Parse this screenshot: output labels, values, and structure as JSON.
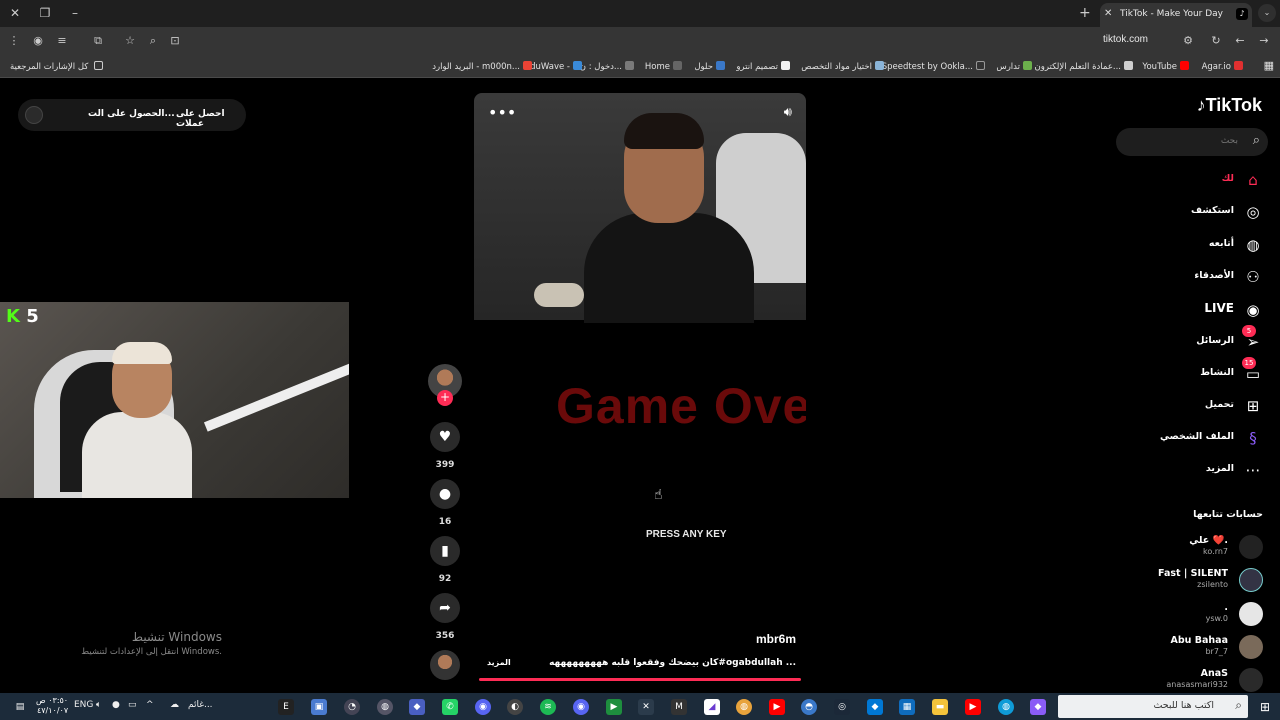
{
  "browser": {
    "tab_title": "TikTok - Make Your Day",
    "url": "tiktok.com",
    "bookmarks_folder": "كل الإشارات المرجعية",
    "bookmarks": [
      {
        "label": "Agar.io",
        "color": "#e03030"
      },
      {
        "label": "YouTube",
        "color": "#ff0000"
      },
      {
        "label": "عمادة التعلم الإلكترون...",
        "color": "#cfcfcf"
      },
      {
        "label": "تدارس",
        "color": "#6cb04c"
      },
      {
        "label": "Speedtest by Ookla...",
        "color": "#333333"
      },
      {
        "label": "اختيار مواد التخصص",
        "color": "#8ab4d8"
      },
      {
        "label": "تصميم انترو",
        "color": "#f0f0f0"
      },
      {
        "label": "حلول",
        "color": "#3a78c8"
      },
      {
        "label": "Home",
        "color": "#666666"
      },
      {
        "label": "دخول : ن...",
        "color": "#7a7a7a"
      },
      {
        "label": "EduWave -",
        "color": "#3a8ad8"
      },
      {
        "label": "البريد الوارد - m000n...",
        "color": "#ea4335"
      }
    ]
  },
  "tiktok": {
    "logo": "TikTok",
    "search_placeholder": "بحث",
    "get_coins": "احصل على عملات",
    "get_app": "الحصول على الت...",
    "nav": [
      {
        "label": "لك",
        "icon": "home-icon",
        "active": true
      },
      {
        "label": "استكشف",
        "icon": "compass-icon"
      },
      {
        "label": "أتابعه",
        "icon": "avatar-icon"
      },
      {
        "label": "الأصدقاء",
        "icon": "friends-icon"
      },
      {
        "label": "LIVE",
        "icon": "live-icon"
      },
      {
        "label": "الرسائل",
        "icon": "send-icon",
        "badge": "5"
      },
      {
        "label": "النشاط",
        "icon": "inbox-icon",
        "badge": "15"
      },
      {
        "label": "تحميل",
        "icon": "upload-icon"
      },
      {
        "label": "الملف الشخصي",
        "icon": "profile-icon"
      },
      {
        "label": "المزيد",
        "icon": "more-icon"
      }
    ],
    "following_title": "حسابات تتابعها",
    "following": [
      {
        "name": "علي ❤️.",
        "user": "ko.rn7"
      },
      {
        "name": "Fast | SILENT",
        "user": "zsilento"
      },
      {
        "name": ".",
        "user": "ysw.0"
      },
      {
        "name": "Abu Bahaa",
        "user": "br7_7"
      },
      {
        "name": "AnaS",
        "user": "anasasmari932"
      }
    ],
    "video": {
      "overlay_text": "Game Ove",
      "press_text": "PRESS ANY KEY",
      "author": "mbr6m",
      "caption": "كان بيضحك وفقعوا قلبه هههههههههه#ogabdullah ...",
      "more": "المزيد",
      "likes": "399",
      "comments": "16",
      "saves": "92",
      "shares": "356",
      "progress": 1.0
    }
  },
  "webcam": {
    "kick_label": "K",
    "kick_count": "5"
  },
  "windows": {
    "activate_title": "تنشيط Windows",
    "activate_sub": "انتقل إلى الإعدادات لتنشيط Windows.",
    "search_placeholder": "اكتب هنا للبحث",
    "weather": "غائم...",
    "lang": "ENG",
    "time": "٠٣:٥٠ ص",
    "date": "٤٧/١٠/٠٧"
  }
}
